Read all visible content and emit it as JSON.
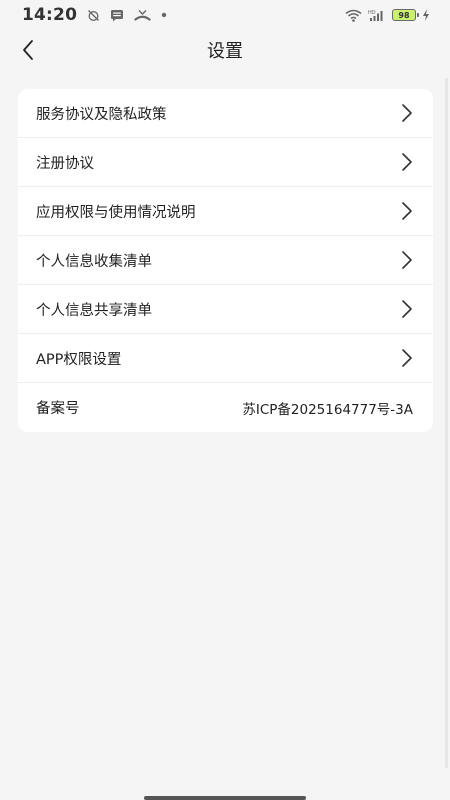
{
  "status_bar": {
    "time": "14:20",
    "battery_level": "98",
    "icons": [
      "alarm-off-icon",
      "message-icon",
      "missed-call-icon",
      "dot-icon",
      "wifi-icon",
      "signal-hd-icon",
      "battery-icon",
      "charging-icon"
    ]
  },
  "header": {
    "title": "设置",
    "back_icon": "chevron-left-icon"
  },
  "settings": {
    "items": [
      {
        "label": "服务协议及隐私政策",
        "icon": "chevron-right-icon"
      },
      {
        "label": "注册协议",
        "icon": "chevron-right-icon"
      },
      {
        "label": "应用权限与使用情况说明",
        "icon": "chevron-right-icon"
      },
      {
        "label": "个人信息收集清单",
        "icon": "chevron-right-icon"
      },
      {
        "label": "个人信息共享清单",
        "icon": "chevron-right-icon"
      },
      {
        "label": "APP权限设置",
        "icon": "chevron-right-icon"
      }
    ],
    "record": {
      "label": "备案号",
      "value": "苏ICP备2025164777号-3A"
    }
  },
  "colors": {
    "background": "#f5f5f5",
    "card": "#ffffff",
    "text": "#222222",
    "battery_fill": "#c9f06e"
  }
}
